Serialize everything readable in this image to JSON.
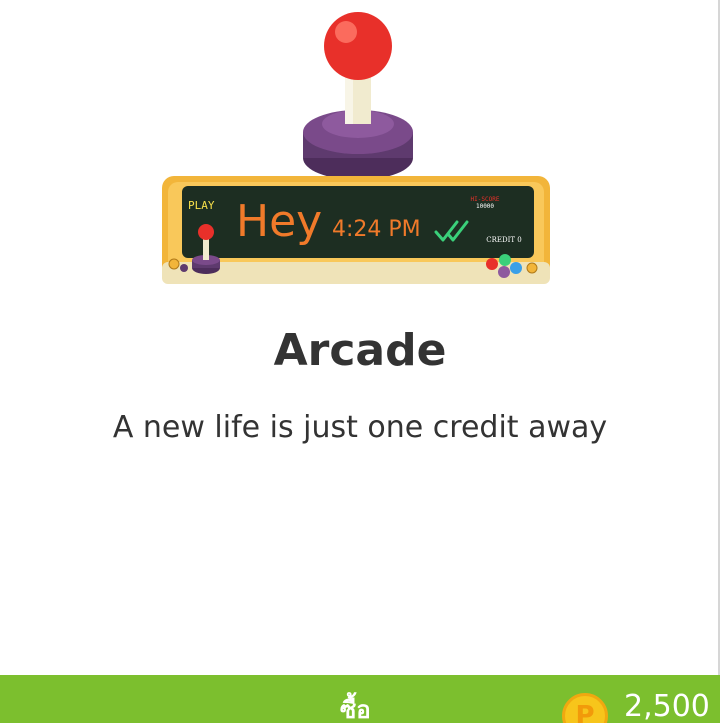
{
  "theme": {
    "title": "Arcade",
    "subtitle": "A new life is just one credit away",
    "preview": {
      "play_label": "PLAY",
      "message_text": "Hey",
      "time_text": "4:24 PM",
      "hiscore_label": "HI-SCORE",
      "hiscore_value": "10000",
      "credit_label": "CREDIT 0"
    }
  },
  "purchase_bar": {
    "buy_label": "ซื้อ",
    "coin_letter": "P",
    "price": "2,500"
  },
  "colors": {
    "accent_green": "#7cbf2e",
    "coin_yellow": "#f7c51b",
    "joystick_red": "#e8302a",
    "joystick_base": "#7a4a8a",
    "cabinet_frame": "#f2b53a",
    "screen_bg": "#1d2e22",
    "message_orange": "#f07a2a",
    "check_green": "#3ad07a"
  }
}
